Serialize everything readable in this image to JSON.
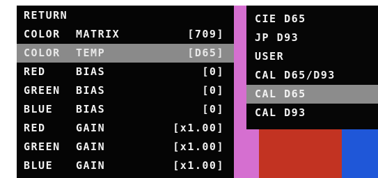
{
  "main_menu": {
    "rows": [
      {
        "label": "RETURN",
        "label2": "",
        "value": ""
      },
      {
        "label": "COLOR",
        "label2": "MATRIX",
        "value": "[709]"
      },
      {
        "label": "COLOR",
        "label2": "TEMP",
        "value": "[D65]"
      },
      {
        "label": "RED",
        "label2": "BIAS",
        "value": "[0]"
      },
      {
        "label": "GREEN",
        "label2": "BIAS",
        "value": "[0]"
      },
      {
        "label": "BLUE",
        "label2": "BIAS",
        "value": "[0]"
      },
      {
        "label": "RED",
        "label2": "GAIN",
        "value": "[x1.00]"
      },
      {
        "label": "GREEN",
        "label2": "GAIN",
        "value": "[x1.00]"
      },
      {
        "label": "BLUE",
        "label2": "GAIN",
        "value": "[x1.00]"
      }
    ]
  },
  "submenu": {
    "items": [
      "CIE D65",
      "JP D93",
      "USER",
      "CAL D65/D93",
      "CAL D65",
      "CAL D93"
    ]
  },
  "colors": {
    "selected_row": "#8a8a8a",
    "background": "#050505",
    "bar_magenta": "#d56fd0",
    "bar_red": "#c23322",
    "bar_blue": "#1f57d8"
  }
}
